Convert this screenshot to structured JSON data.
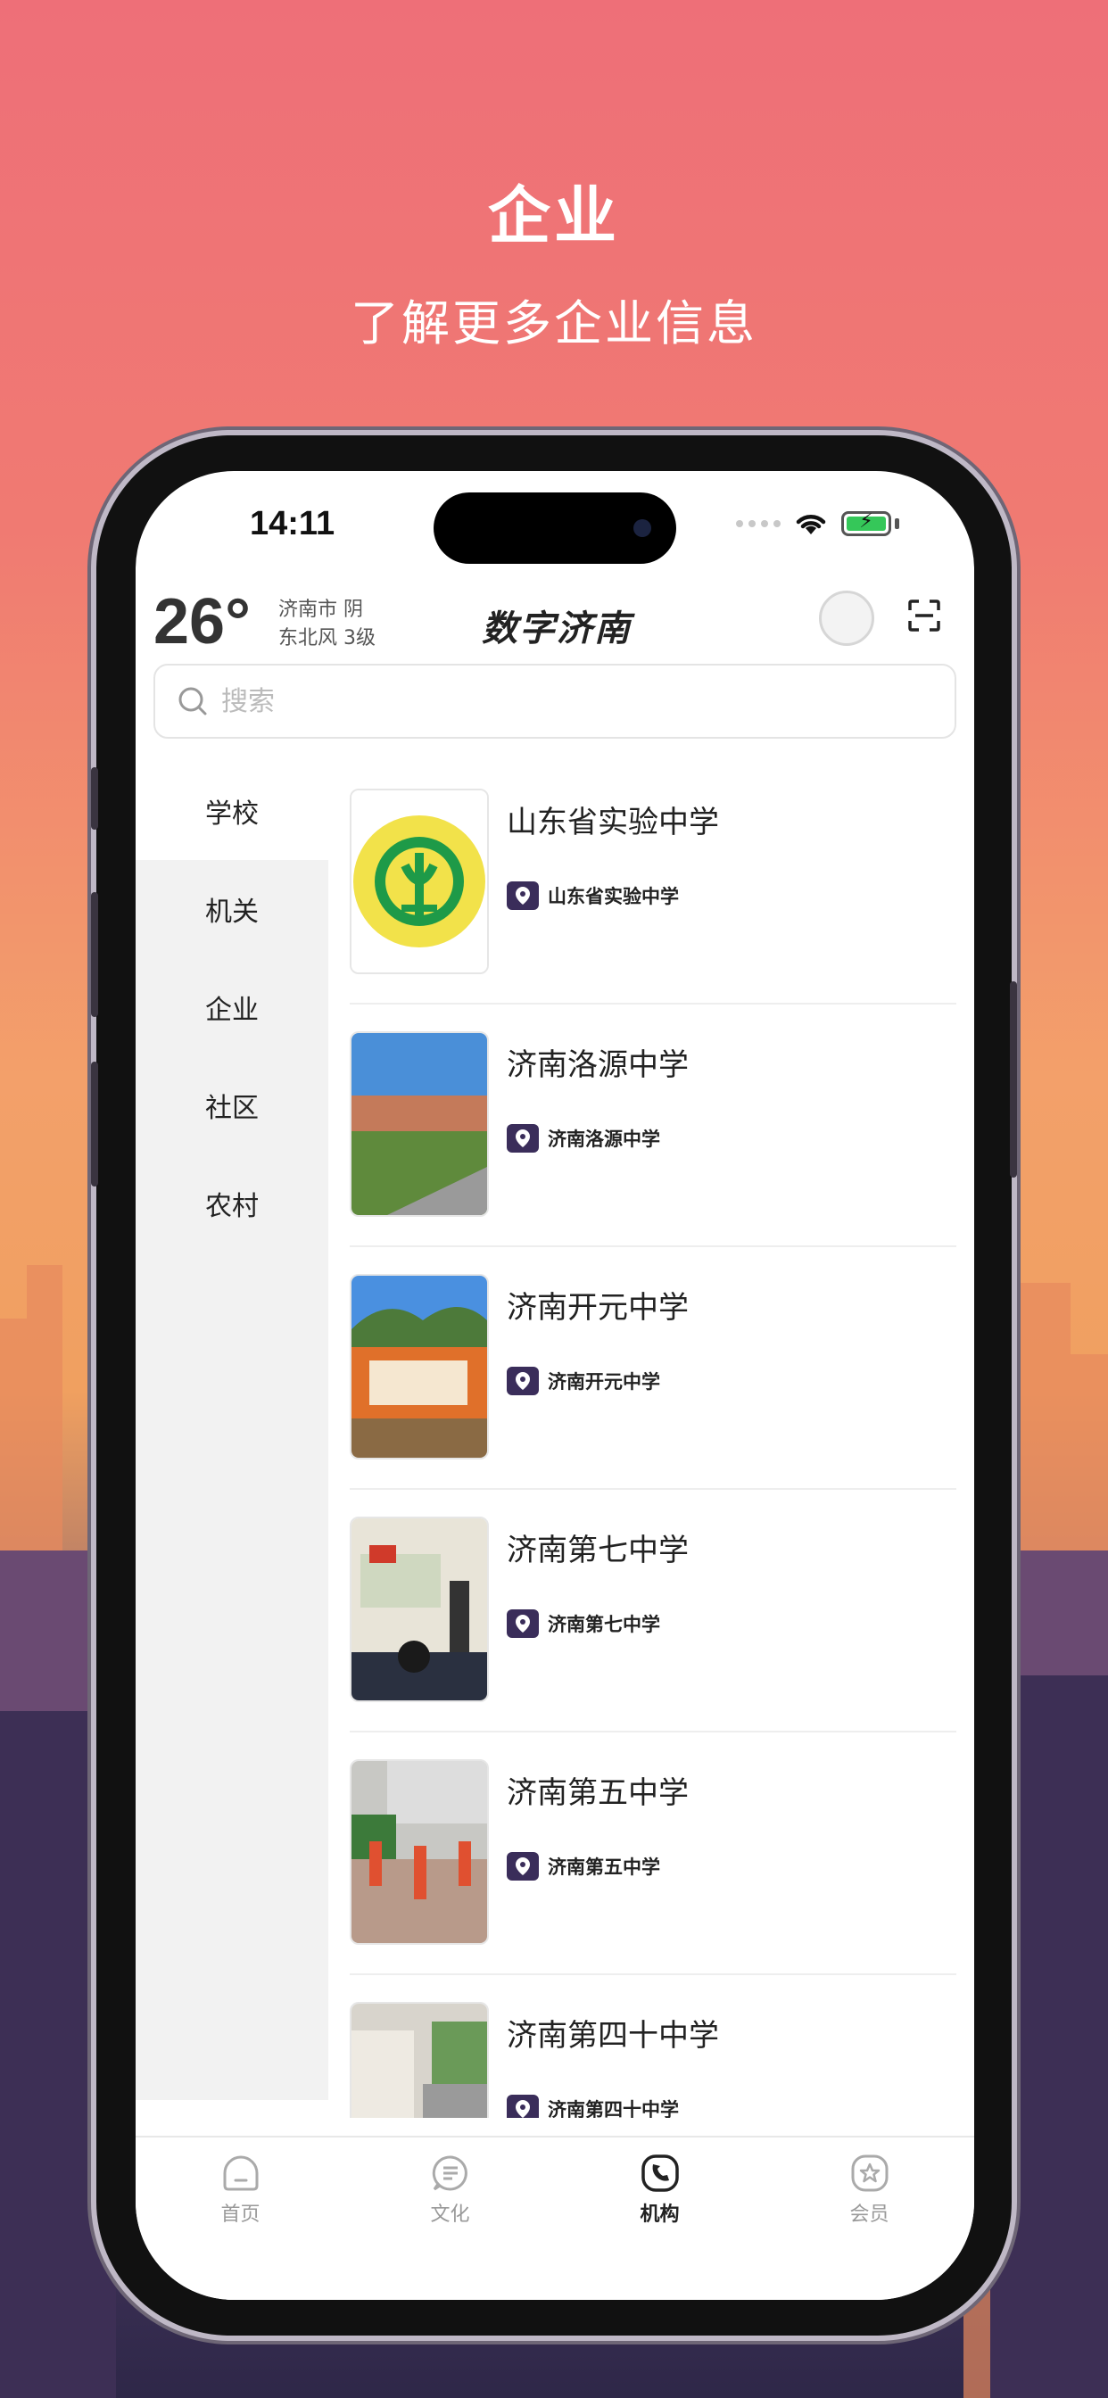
{
  "promo": {
    "title": "企业",
    "subtitle": "了解更多企业信息"
  },
  "status_bar": {
    "time": "14:11"
  },
  "header": {
    "temperature": "26°",
    "weather_line1": "济南市 阴",
    "weather_line2": "东北风 3级",
    "app_title": "数字济南",
    "avatar_icon": "avatar-icon",
    "scan_icon": "scan-icon"
  },
  "search": {
    "placeholder": "搜索"
  },
  "sidebar": {
    "items": [
      {
        "label": "学校",
        "active": true
      },
      {
        "label": "机关",
        "active": false
      },
      {
        "label": "企业",
        "active": false
      },
      {
        "label": "社区",
        "active": false
      },
      {
        "label": "农村",
        "active": false
      }
    ]
  },
  "list": {
    "items": [
      {
        "name": "山东省实验中学",
        "tag": "山东省实验中学"
      },
      {
        "name": "济南洛源中学",
        "tag": "济南洛源中学"
      },
      {
        "name": "济南开元中学",
        "tag": "济南开元中学"
      },
      {
        "name": "济南第七中学",
        "tag": "济南第七中学"
      },
      {
        "name": "济南第五中学",
        "tag": "济南第五中学"
      },
      {
        "name": "济南第四十中学",
        "tag": "济南第四十中学"
      }
    ]
  },
  "tabbar": {
    "tabs": [
      {
        "label": "首页",
        "icon": "home-icon",
        "active": false
      },
      {
        "label": "文化",
        "icon": "culture-icon",
        "active": false
      },
      {
        "label": "机构",
        "icon": "institution-icon",
        "active": true
      },
      {
        "label": "会员",
        "icon": "member-icon",
        "active": false
      }
    ]
  },
  "colors": {
    "accent": "#3a2d5a",
    "battery": "#35c759",
    "promo_top": "#ee6f78"
  }
}
